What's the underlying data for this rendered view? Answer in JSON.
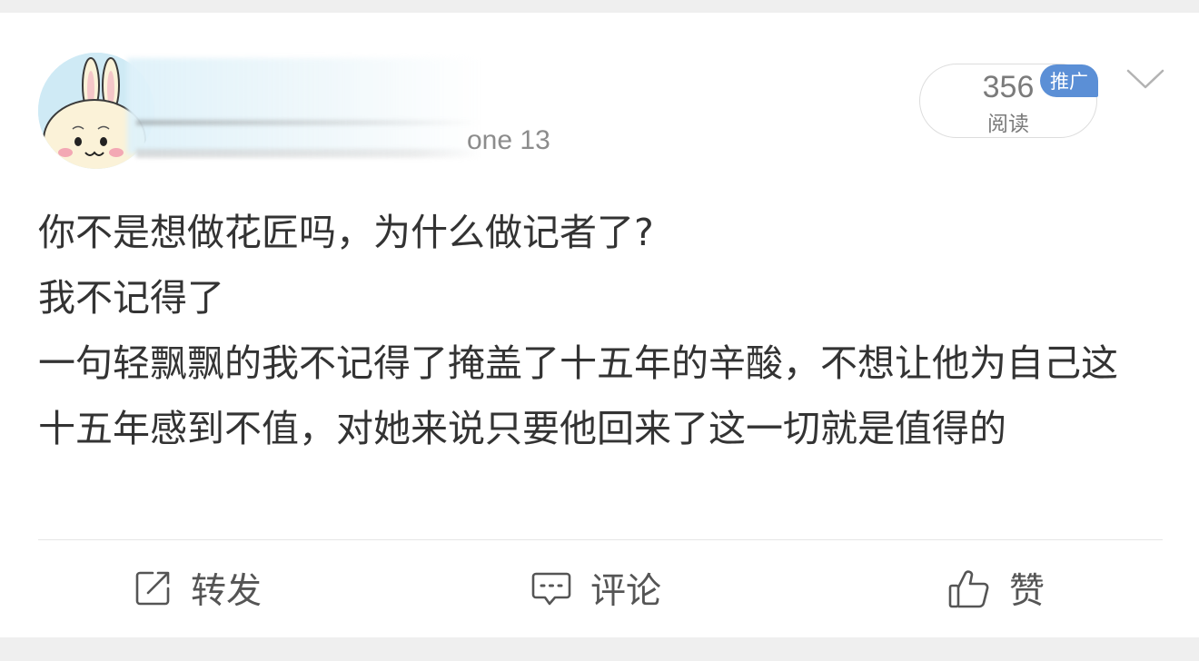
{
  "header": {
    "device_suffix": "one 13",
    "read_count": "356",
    "read_label": "阅读",
    "promo_badge": "推广"
  },
  "post": {
    "lines": [
      "你不是想做花匠吗，为什么做记者了?",
      "我不记得了",
      "一句轻飘飘的我不记得了掩盖了十五年的辛酸，不想让他为自己这十五年感到不值，对她来说只要他回来了这一切就是值得的"
    ]
  },
  "actions": {
    "repost_label": "转发",
    "comment_label": "评论",
    "like_label": "赞"
  },
  "colors": {
    "badge": "#5b8fd6",
    "background": "#efefef",
    "text": "#333333"
  }
}
